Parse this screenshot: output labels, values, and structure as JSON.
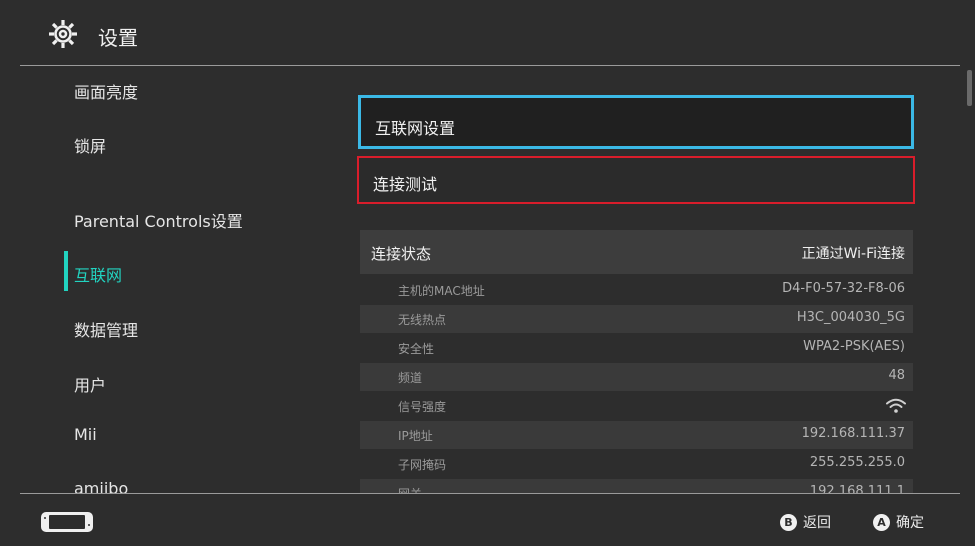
{
  "header": {
    "title": "设置",
    "icon": "gear-icon"
  },
  "sidebar": {
    "items": [
      {
        "label": "画面亮度"
      },
      {
        "label": "锁屏"
      },
      {
        "label": "Parental Controls设置"
      },
      {
        "label": "互联网",
        "active": true
      },
      {
        "label": "数据管理"
      },
      {
        "label": "用户"
      },
      {
        "label": "Mii"
      },
      {
        "label": "amiibo"
      }
    ]
  },
  "main": {
    "internet_settings_label": "互联网设置",
    "connection_test_label": "连接测试",
    "status": {
      "label": "连接状态",
      "value": "正通过Wi-Fi连接",
      "rows": [
        {
          "key": "主机的MAC地址",
          "value": "D4-F0-57-32-F8-06"
        },
        {
          "key": "无线热点",
          "value": "H3C_004030_5G"
        },
        {
          "key": "安全性",
          "value": "WPA2-PSK(AES)"
        },
        {
          "key": "频道",
          "value": "48"
        },
        {
          "key": "信号强度",
          "value": "",
          "icon": "wifi-signal-icon"
        },
        {
          "key": "IP地址",
          "value": "192.168.111.37"
        },
        {
          "key": "子网掩码",
          "value": "255.255.255.0"
        },
        {
          "key": "网关",
          "value": "192.168.111.1"
        }
      ]
    }
  },
  "footer": {
    "console_icon": "handheld-console-icon",
    "back_key": "B",
    "back_label": "返回",
    "ok_key": "A",
    "ok_label": "确定"
  },
  "colors": {
    "background": "#2d2d2d",
    "accent_active": "#22d3c0",
    "focus_border": "#3bb9e6",
    "highlight_red": "#d91d2b"
  }
}
